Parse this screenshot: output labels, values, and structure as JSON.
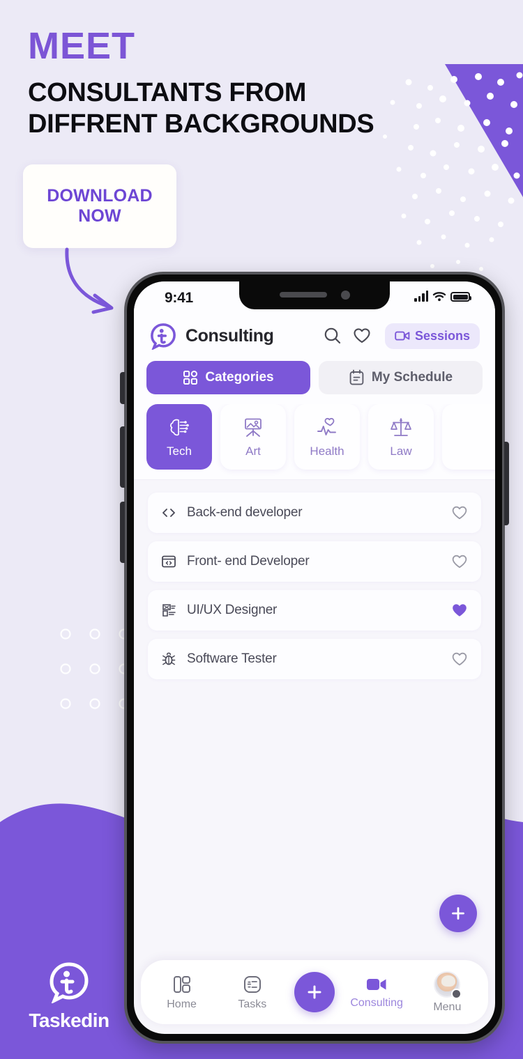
{
  "poster": {
    "eyebrow": "MEET",
    "headline_line1": "CONSULTANTS FROM",
    "headline_line2": "DIFFRENT BACKGROUNDS",
    "cta_label": "DOWNLOAD\nNOW",
    "cta_line1": "DOWNLOAD",
    "cta_line2": "NOW",
    "brand_name": "Taskedin",
    "colors": {
      "background": "#eceaf6",
      "accent_purple": "#7b57d9",
      "headline_purple": "#7c55d6",
      "cta_text": "#6d46d4",
      "dark_text": "#0d0d12",
      "card_white": "#fffefb",
      "wave_purple": "#7b57d9"
    }
  },
  "phone": {
    "statusbar": {
      "time": "9:41",
      "icons": [
        "signal-icon",
        "wifi-icon",
        "battery-icon"
      ]
    },
    "header": {
      "logo": "taskedin-logo-icon",
      "title": "Consulting",
      "search_icon": "search-icon",
      "favorite_icon": "heart-icon",
      "sessions": {
        "label": "Sessions",
        "icon": "video-camera-icon"
      }
    },
    "segments": [
      {
        "label": "Categories",
        "icon": "grid-icon",
        "active": true
      },
      {
        "label": "My Schedule",
        "icon": "calendar-icon",
        "active": false
      }
    ],
    "categories": [
      {
        "label": "Tech",
        "icon": "brain-circuit-icon",
        "active": true
      },
      {
        "label": "Art",
        "icon": "easel-picture-icon",
        "active": false
      },
      {
        "label": "Health",
        "icon": "heart-pulse-icon",
        "active": false
      },
      {
        "label": "Law",
        "icon": "scales-icon",
        "active": false
      },
      {
        "label": "",
        "icon": "partial-chip",
        "active": false
      }
    ],
    "list": [
      {
        "label": "Back-end developer",
        "icon": "code-brackets-icon",
        "favorited": false
      },
      {
        "label": "Front- end Developer",
        "icon": "browser-code-icon",
        "favorited": false
      },
      {
        "label": "UI/UX Designer",
        "icon": "design-palette-icon",
        "favorited": true
      },
      {
        "label": "Software Tester",
        "icon": "bug-icon",
        "favorited": false
      }
    ],
    "fab": {
      "icon": "plus-icon",
      "label": "+"
    },
    "bottom_nav": [
      {
        "label": "Home",
        "icon": "dashboard-icon",
        "active": false
      },
      {
        "label": "Tasks",
        "icon": "checklist-icon",
        "active": false
      },
      {
        "label": "+",
        "icon": "plus-icon",
        "active": false,
        "center": true
      },
      {
        "label": "Consulting",
        "icon": "video-camera-icon",
        "active": true
      },
      {
        "label": "Menu",
        "icon": "avatar-icon",
        "active": false
      }
    ]
  }
}
